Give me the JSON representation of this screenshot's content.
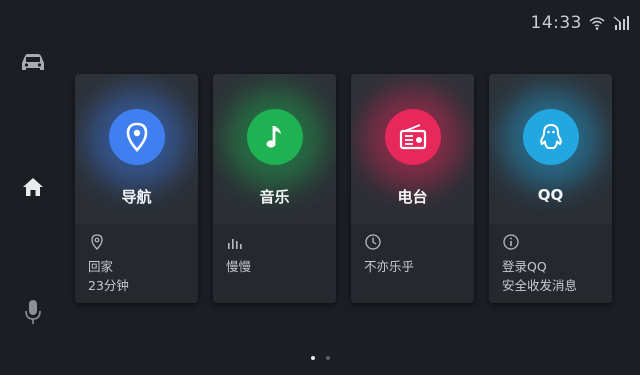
{
  "status": {
    "time": "14:33",
    "icons": [
      "wifi-icon",
      "signal-icon"
    ]
  },
  "sidebar": {
    "items": [
      "car-icon",
      "home-icon",
      "microphone-icon"
    ],
    "active": "home-icon"
  },
  "cards": [
    {
      "title": "导航",
      "color": "#3f7ff0",
      "icon": "location-pin-icon",
      "info_icon": "pin-outline-icon",
      "line1": "回家",
      "line2": "23分钟"
    },
    {
      "title": "音乐",
      "color": "#1fb152",
      "icon": "music-note-icon",
      "info_icon": "equalizer-icon",
      "line1": "慢慢",
      "line2": ""
    },
    {
      "title": "电台",
      "color": "#e6285a",
      "icon": "radio-icon",
      "info_icon": "clock-icon",
      "line1": "不亦乐乎",
      "line2": ""
    },
    {
      "title": "QQ",
      "color": "#23a7e0",
      "icon": "qq-penguin-icon",
      "info_icon": "info-circle-icon",
      "line1": "登录QQ",
      "line2": "安全收发消息"
    }
  ],
  "pager": {
    "count": 2,
    "active": 0
  }
}
